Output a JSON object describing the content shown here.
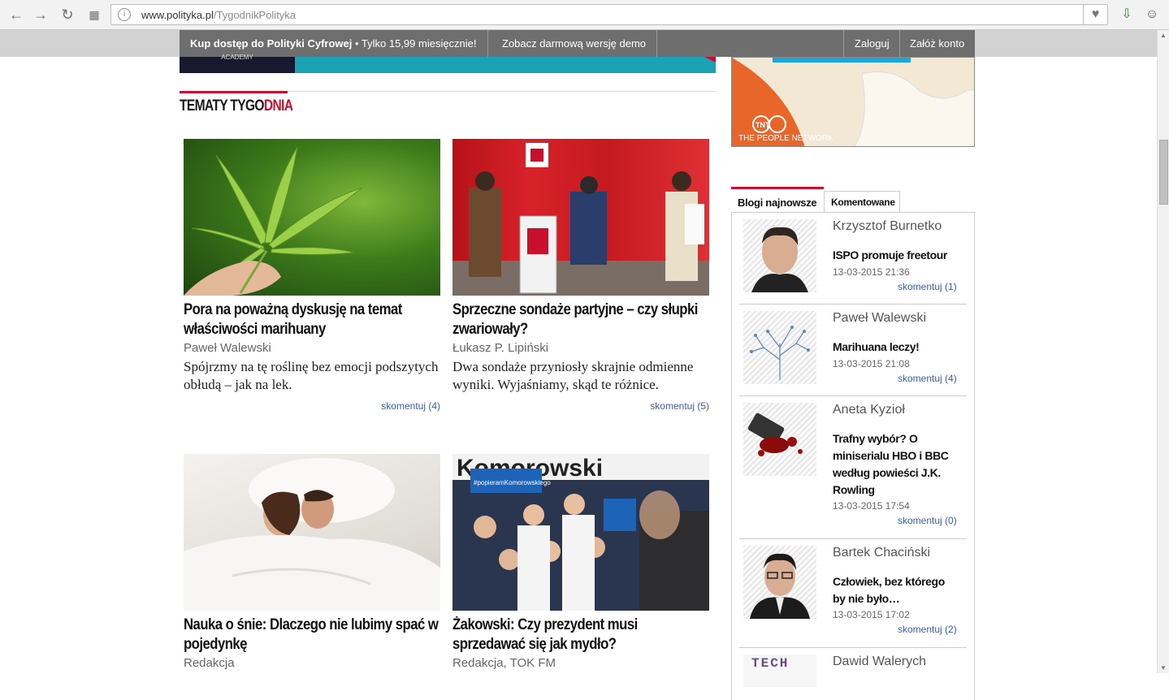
{
  "browser": {
    "url_domain": "www.polityka.pl",
    "url_path": "/TygodnikPolityka"
  },
  "topbar": {
    "promo_bold": "Kup dostęp do Polityki Cyfrowej",
    "promo_rest": " • Tylko 15,99 miesięcznie!",
    "demo": "Zobacz darmową wersję demo",
    "login": "Zaloguj",
    "register": "Załóż konto"
  },
  "ad": {
    "academy": "ACADEMY",
    "tnt_logo": "TNT",
    "tnt_slogan": "THE PEOPLE NETWORK"
  },
  "section": {
    "title_black": "TEMATY TYGO",
    "title_red": "DNIA"
  },
  "articles": [
    {
      "title": "Pora na poważną dyskusję na temat właściwości marihuany",
      "author": "Paweł Walewski",
      "lead": "Spójrzmy na tę roślinę bez emocji podszytych obłudą – jak na lek.",
      "comments": "skomentuj (4)"
    },
    {
      "title": "Sprzeczne sondaże partyjne – czy słupki zwariowały?",
      "author": "Łukasz P. Lipiński",
      "lead": "Dwa sondaże przyniosły skrajnie odmienne wyniki. Wyjaśniamy, skąd te różnice.",
      "comments": "skomentuj (5)"
    },
    {
      "title": "Nauka o śnie: Dlaczego nie lubimy spać w pojedynkę",
      "author": "Redakcja"
    },
    {
      "title": "Żakowski: Czy prezydent musi sprzedawać się jak mydło?",
      "author": "Redakcja, TOK FM",
      "banner": "Komorowski",
      "sign": "#popieramKomorowskiego"
    }
  ],
  "sidebar": {
    "tab_active": "Blogi najnowsze",
    "tab_inactive": "Komentowane",
    "entries": [
      {
        "author": "Krzysztof Burnetko",
        "title": "ISPO promuje freetour",
        "date": "13-03-2015 21:36",
        "comments": "skomentuj (1)"
      },
      {
        "author": "Paweł Walewski",
        "title": "Marihuana leczy!",
        "date": "13-03-2015 21:08",
        "comments": "skomentuj (4)"
      },
      {
        "author": "Aneta Kyzioł",
        "title": "Trafny wybór? O miniserialu HBO i BBC według powieści J.K. Rowling",
        "date": "13-03-2015 17:54",
        "comments": "skomentuj (0)"
      },
      {
        "author": "Bartek Chaciński",
        "title": "Człowiek, bez którego by nie było…",
        "date": "13-03-2015 17:02",
        "comments": "skomentuj (2)"
      },
      {
        "author": "Dawid Walerych",
        "thumb_text": "TECH"
      }
    ]
  },
  "colors": {
    "accent": "#c8102e",
    "link": "#3a5ea8",
    "topbar": "#6e6e6e"
  }
}
